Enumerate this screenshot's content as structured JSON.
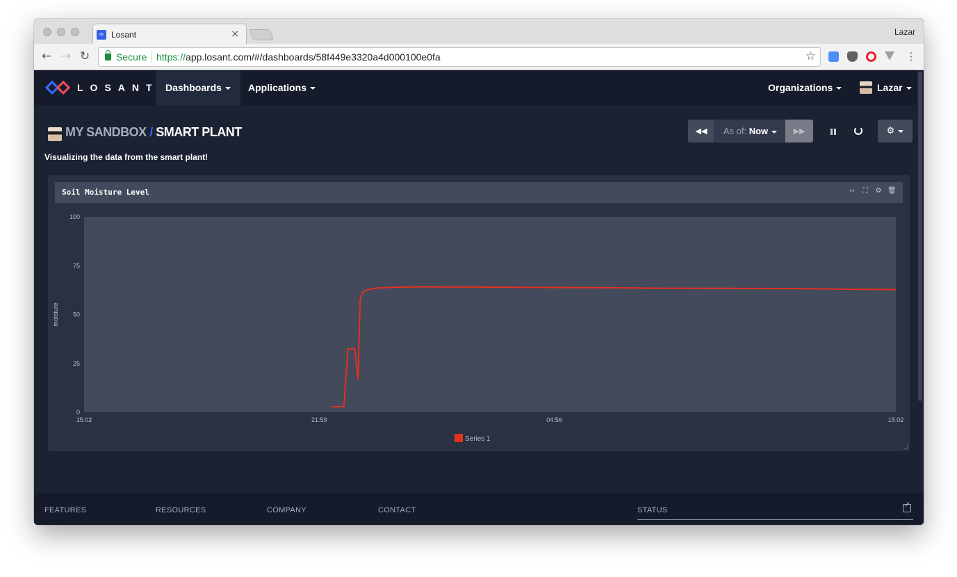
{
  "browser": {
    "tab_title": "Losant",
    "profile_name": "Lazar",
    "secure_label": "Secure",
    "url_scheme": "https://",
    "url_rest": "app.losant.com/#/dashboards/58f449e3320a4d000100e0fa"
  },
  "nav": {
    "logo_text": "LOSANT",
    "dashboards": "Dashboards",
    "applications": "Applications",
    "organizations": "Organizations",
    "user": "Lazar"
  },
  "dashboard": {
    "parent": "MY SANDBOX",
    "separator": "/",
    "title": "SMART PLANT",
    "description": "Visualizing the data from the smart plant!"
  },
  "timebar": {
    "as_of_label": "As of:",
    "as_of_value": "Now"
  },
  "block": {
    "title": "Soil Moisture Level",
    "legend_label": "Series 1"
  },
  "chart_data": {
    "type": "line",
    "ylabel": "moisture",
    "ylim": [
      0,
      100
    ],
    "y_ticks": [
      "100",
      "75",
      "50",
      "25",
      "0"
    ],
    "x_ticks": [
      "15:02",
      "21:59",
      "04:56",
      "15:02"
    ],
    "x_tick_values": [
      0,
      6.95,
      13.9,
      24
    ],
    "xlim": [
      0,
      24
    ],
    "series": [
      {
        "name": "Series 1",
        "color": "#e33121",
        "x": [
          7.3,
          7.68,
          7.8,
          7.86,
          8.0,
          8.1,
          8.16,
          8.22,
          8.33,
          8.6,
          9.1,
          10.0,
          11.5,
          13.0,
          15.0,
          17.0,
          19.0,
          21.0,
          23.0,
          24.0
        ],
        "y": [
          2.8,
          2.8,
          32.5,
          32.5,
          32.5,
          17,
          57,
          61,
          62.4,
          63.5,
          64,
          64.2,
          64.1,
          63.9,
          63.8,
          63.5,
          63.4,
          63.3,
          62.9,
          62.8
        ]
      }
    ]
  },
  "footer": {
    "features": "FEATURES",
    "resources": "RESOURCES",
    "company": "COMPANY",
    "contact": "CONTACT",
    "status": "STATUS"
  },
  "colors": {
    "accent": "#3a67ff",
    "background": "#1b2232",
    "nav": "#151b2a",
    "series": "#e33121"
  }
}
